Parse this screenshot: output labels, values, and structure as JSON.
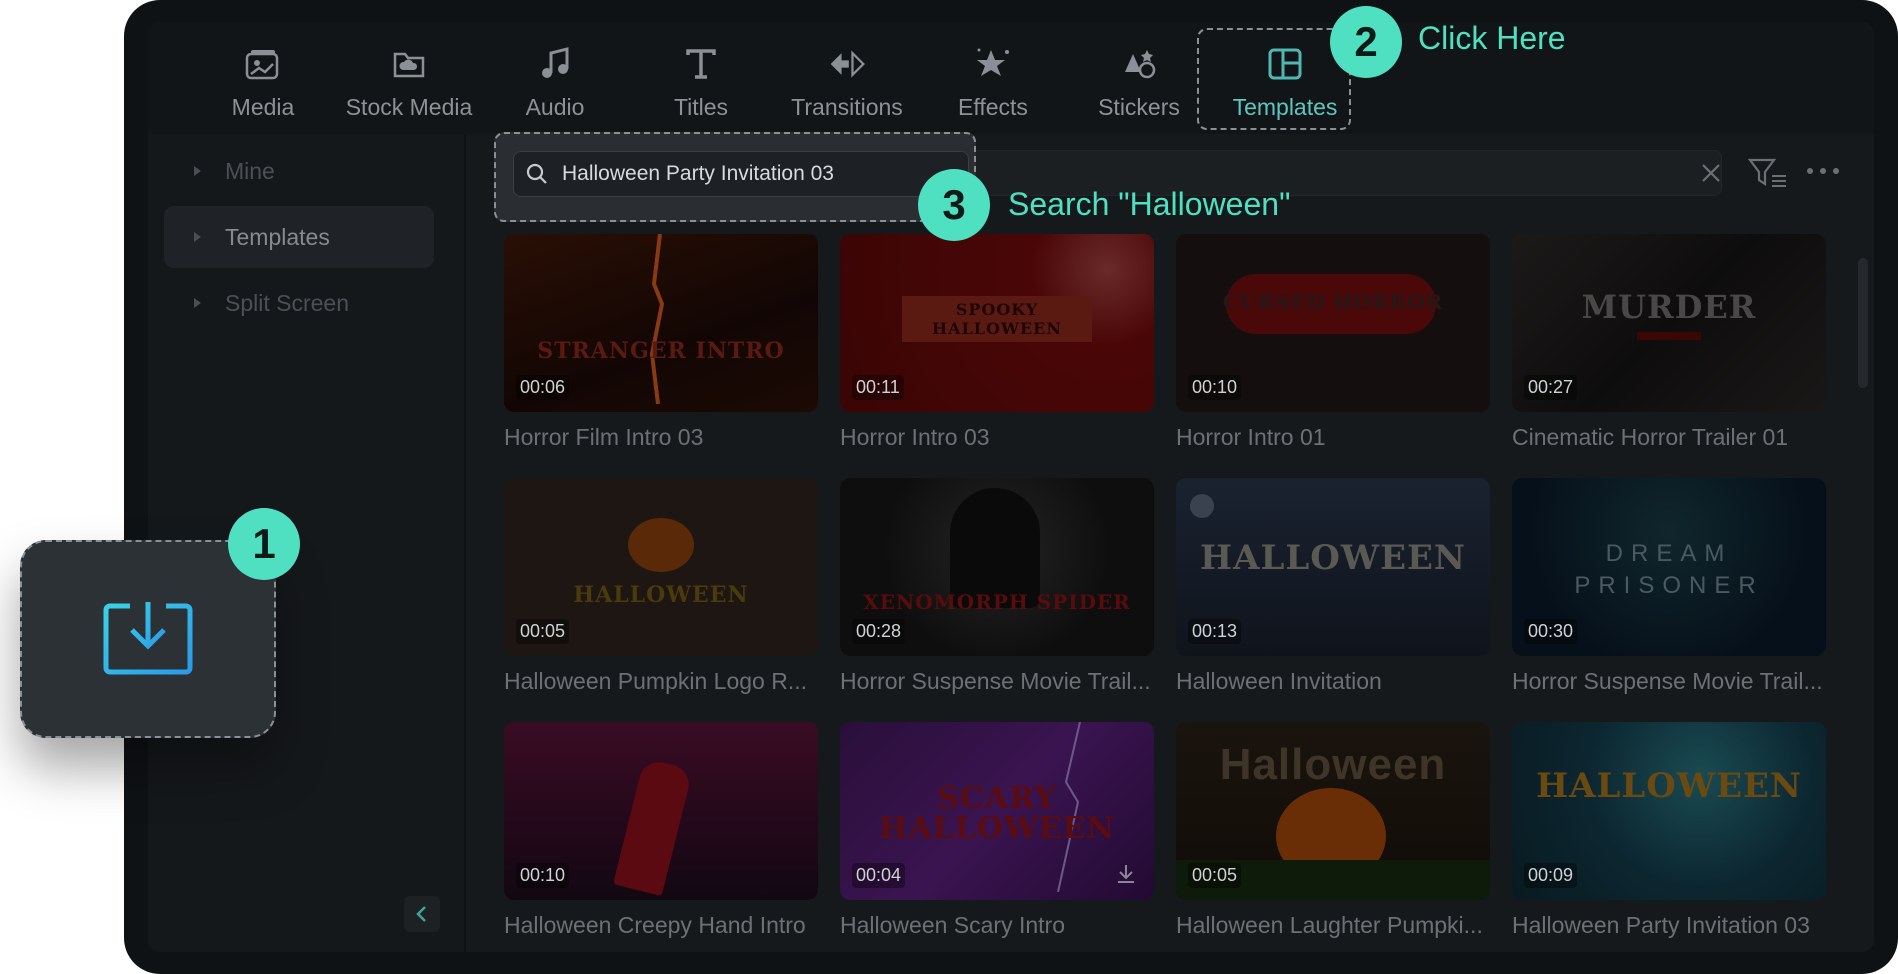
{
  "toolbar": {
    "tabs": [
      {
        "label": "Media",
        "icon": "media-icon"
      },
      {
        "label": "Stock Media",
        "icon": "stock-media-icon"
      },
      {
        "label": "Audio",
        "icon": "music-note-icon"
      },
      {
        "label": "Titles",
        "icon": "text-t-icon"
      },
      {
        "label": "Transitions",
        "icon": "transitions-icon"
      },
      {
        "label": "Effects",
        "icon": "effects-star-icon"
      },
      {
        "label": "Stickers",
        "icon": "stickers-icon"
      },
      {
        "label": "Templates",
        "icon": "templates-icon",
        "active": true
      }
    ]
  },
  "sidebar": {
    "items": [
      {
        "label": "Mine"
      },
      {
        "label": "Templates",
        "selected": true
      },
      {
        "label": "Split Screen"
      }
    ]
  },
  "search": {
    "value": "Halloween Party Invitation 03"
  },
  "templates": [
    {
      "name": "Horror Film Intro 03",
      "duration": "00:06",
      "thumb_text": "STRANGER INTRO"
    },
    {
      "name": "Horror Intro 03",
      "duration": "00:11",
      "thumb_text": "SPOOKY HALLOWEEN"
    },
    {
      "name": "Horror Intro 01",
      "duration": "00:10",
      "thumb_text": "CURSED HORROR"
    },
    {
      "name": "Cinematic Horror Trailer 01",
      "duration": "00:27",
      "thumb_text": "MURDER"
    },
    {
      "name": "Halloween Pumpkin Logo R...",
      "duration": "00:05",
      "thumb_text": "HALLOWEEN"
    },
    {
      "name": "Horror Suspense Movie Trail...",
      "duration": "00:28",
      "thumb_text": "XENOMORPH SPIDER"
    },
    {
      "name": "Halloween Invitation",
      "duration": "00:13",
      "thumb_text": "HALLOWEEN"
    },
    {
      "name": "Horror Suspense Movie Trail...",
      "duration": "00:30",
      "thumb_text": "DREAM PRISONER"
    },
    {
      "name": "Halloween Creepy Hand Intro",
      "duration": "00:10",
      "thumb_text": ""
    },
    {
      "name": "Halloween Scary Intro",
      "duration": "00:04",
      "thumb_text": "SCARY HALLOWEEN"
    },
    {
      "name": "Halloween Laughter Pumpki...",
      "duration": "00:05",
      "thumb_text": "Halloween"
    },
    {
      "name": "Halloween Party Invitation 03",
      "duration": "00:09",
      "thumb_text": "HALLOWEEN"
    }
  ],
  "steps": [
    {
      "number": "1",
      "label": ""
    },
    {
      "number": "2",
      "label": "Click Here"
    },
    {
      "number": "3",
      "label": "Search \"Halloween\""
    }
  ],
  "colors": {
    "accent": "#4ee0c0",
    "active_tab": "#5ec6c0",
    "background": "#16191c"
  }
}
